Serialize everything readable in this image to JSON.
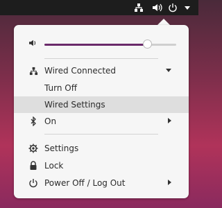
{
  "topbar": {
    "icons": [
      "network-icon",
      "volume-icon",
      "power-icon",
      "menu-arrow-icon"
    ]
  },
  "volume": {
    "level_percent": 78,
    "icon": "volume-icon"
  },
  "menu": {
    "network": {
      "label": "Wired Connected",
      "icon": "network-icon"
    },
    "network_sub": [
      "Turn Off",
      "Wired Settings"
    ],
    "bluetooth": {
      "label": "On",
      "icon": "bluetooth-icon"
    },
    "settings": {
      "label": "Settings",
      "icon": "gear-icon"
    },
    "lock": {
      "label": "Lock",
      "icon": "lock-icon"
    },
    "power": {
      "label": "Power Off / Log Out",
      "icon": "power-icon"
    }
  },
  "colors": {
    "accent": "#6a2a6a",
    "popup_bg": "#f6f6f6",
    "topbar_bg": "#1d1d1d"
  }
}
